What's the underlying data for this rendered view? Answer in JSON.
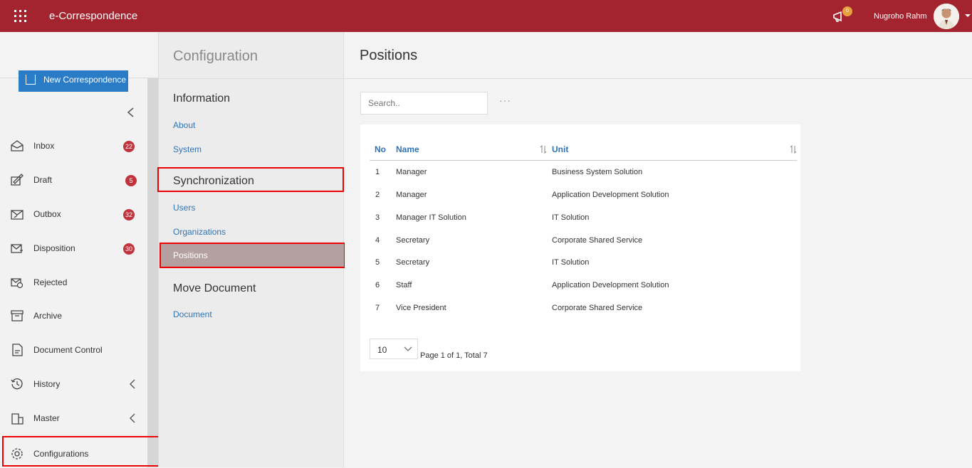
{
  "header": {
    "app_title": "e-Correspondence",
    "notification_count": "0",
    "user_name": "Nugroho Rahm"
  },
  "sidebar": {
    "new_button": "New Correspondence",
    "items": [
      {
        "label": "Inbox",
        "badge": "22",
        "icon": "inbox-icon"
      },
      {
        "label": "Draft",
        "badge": "5",
        "icon": "draft-icon"
      },
      {
        "label": "Outbox",
        "badge": "32",
        "icon": "outbox-icon"
      },
      {
        "label": "Disposition",
        "badge": "30",
        "icon": "disposition-icon"
      },
      {
        "label": "Rejected",
        "badge": "",
        "icon": "rejected-icon"
      },
      {
        "label": "Archive",
        "badge": "",
        "icon": "archive-icon"
      },
      {
        "label": "Document Control",
        "badge": "",
        "icon": "document-control-icon"
      },
      {
        "label": "History",
        "badge": "",
        "icon": "history-icon"
      },
      {
        "label": "Master",
        "badge": "",
        "icon": "master-icon"
      },
      {
        "label": "Configurations",
        "badge": "",
        "icon": "gear-icon"
      }
    ]
  },
  "config": {
    "title": "Configuration",
    "sections": [
      {
        "heading": "Information",
        "links": [
          "About",
          "System"
        ]
      },
      {
        "heading": "Synchronization",
        "links": [
          "Users",
          "Organizations",
          "Positions"
        ]
      },
      {
        "heading": "Move Document",
        "links": [
          "Document"
        ]
      }
    ],
    "active_link": "Positions"
  },
  "main": {
    "title": "Positions",
    "search_placeholder": "Search..",
    "more_label": "···",
    "columns": [
      "No",
      "Name",
      "Unit"
    ],
    "rows": [
      [
        "1",
        "Manager",
        "Business System Solution"
      ],
      [
        "2",
        "Manager",
        "Application Development Solution"
      ],
      [
        "3",
        "Manager IT Solution",
        "IT Solution"
      ],
      [
        "4",
        "Secretary",
        "Corporate Shared Service"
      ],
      [
        "5",
        "Secretary",
        "IT Solution"
      ],
      [
        "6",
        "Staff",
        "Application Development Solution"
      ],
      [
        "7",
        "Vice President",
        "Corporate Shared Service"
      ]
    ],
    "page_size": "10",
    "page_info": "Page 1 of 1, Total 7"
  },
  "colors": {
    "brand": "#a3232e",
    "link": "#2f74b5",
    "badge": "#c0323c",
    "active_item": "#b5a0a0",
    "highlight_border": "#ee0000"
  }
}
